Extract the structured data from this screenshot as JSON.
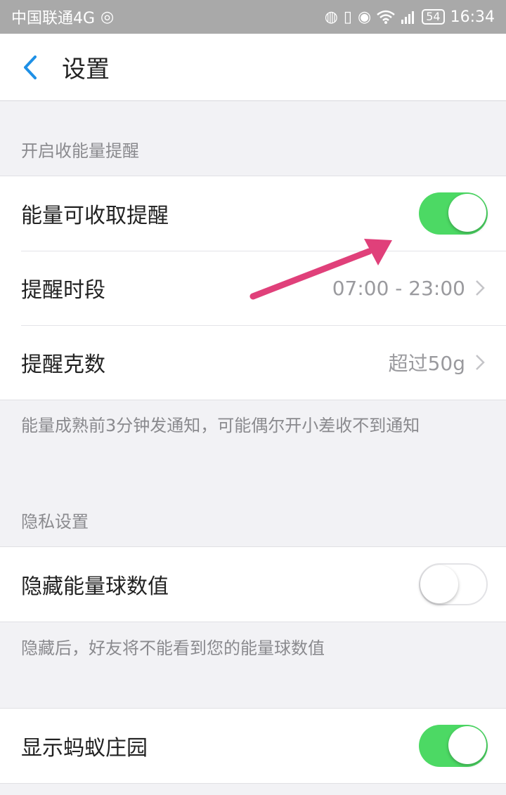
{
  "status_bar": {
    "carrier": "中国联通4G",
    "weibo_icon": "weibo-icon",
    "battery": "54",
    "time": "16:34",
    "icons": [
      "hd-call-icon",
      "vibrate-icon",
      "eye-icon",
      "wifi-icon",
      "signal-icon",
      "battery-icon"
    ]
  },
  "nav": {
    "title": "设置",
    "back_icon": "back-chevron-icon"
  },
  "sections": {
    "energy_reminder": {
      "header": "开启收能量提醒",
      "rows": {
        "collectible": {
          "label": "能量可收取提醒",
          "toggle_on": true
        },
        "time_period": {
          "label": "提醒时段",
          "value": "07:00 - 23:00"
        },
        "grams": {
          "label": "提醒克数",
          "value": "超过50g"
        }
      },
      "footnote": "能量成熟前3分钟发通知，可能偶尔开小差收不到通知"
    },
    "privacy": {
      "header": "隐私设置",
      "rows": {
        "hide_values": {
          "label": "隐藏能量球数值",
          "toggle_on": false
        }
      },
      "footnote": "隐藏后，好友将不能看到您的能量球数值"
    },
    "farm": {
      "rows": {
        "show_farm": {
          "label": "显示蚂蚁庄园",
          "toggle_on": true
        }
      }
    }
  },
  "colors": {
    "accent_blue": "#1e90e6",
    "toggle_green": "#4cd964",
    "annotation_arrow": "#e0407a"
  }
}
